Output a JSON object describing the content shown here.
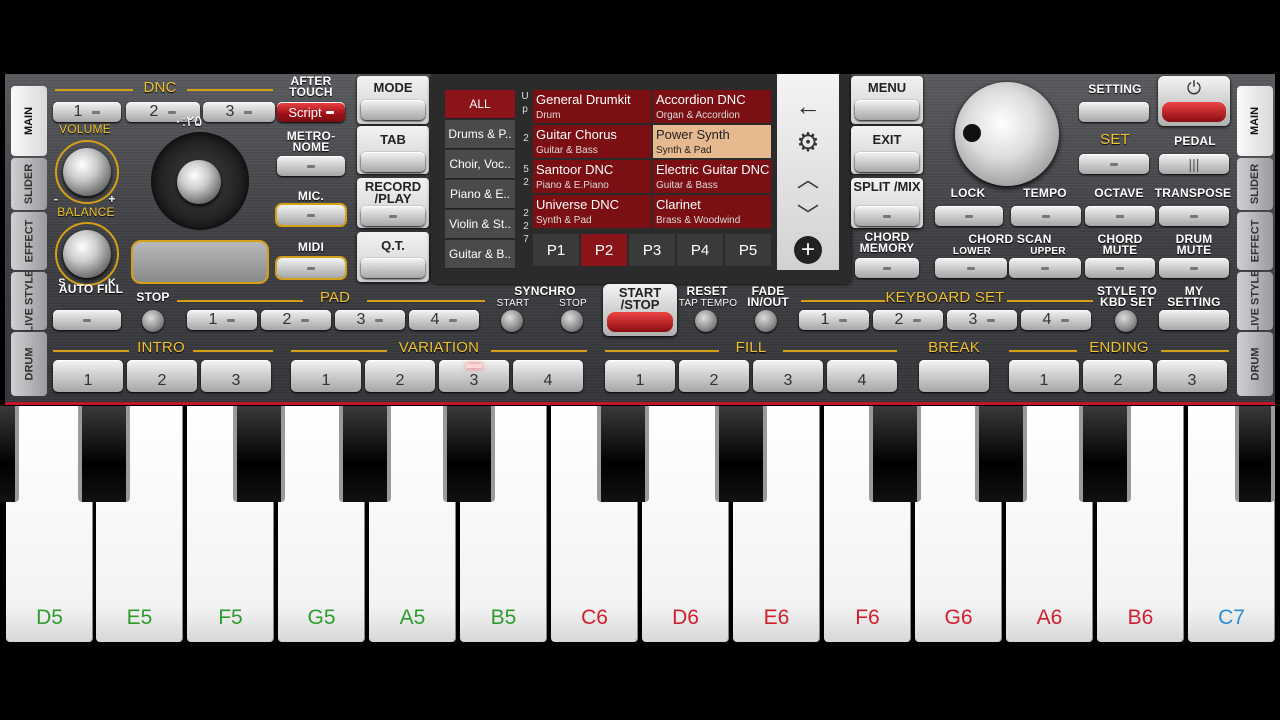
{
  "side_tabs_left": [
    "MAIN",
    "SLIDER",
    "EFFECT",
    "LIVE STYLE",
    "DRUM"
  ],
  "side_tabs_right": [
    "MAIN",
    "SLIDER",
    "EFFECT",
    "LIVE STYLE",
    "DRUM"
  ],
  "dnc": {
    "label": "DNC",
    "buttons": [
      "1",
      "2",
      "3"
    ],
    "overlay": "۰:۲۵"
  },
  "after_touch": {
    "label": "AFTER TOUCH",
    "value": "Script"
  },
  "volume_label": "VOLUME",
  "balance": {
    "label": "BALANCE",
    "s": "S",
    "k": "K",
    "minus": "-",
    "plus": "+"
  },
  "metronome_label": "METRO-NOME",
  "mic_label": "MIC.",
  "midi_label": "MIDI",
  "mode_col": {
    "mode": "MODE",
    "tab": "TAB",
    "record": "RECORD /PLAY",
    "qt": "Q.T."
  },
  "display": {
    "categories": [
      "ALL",
      "Drums & P..",
      "Choir, Voc..",
      "Piano & E..",
      "Violin & St..",
      "Guitar & B.."
    ],
    "up_label": "U p",
    "page_digits": [
      "2",
      "5",
      "2",
      "2",
      "2",
      "7"
    ],
    "voices": [
      {
        "name": "General Drumkit",
        "cat": "Drum"
      },
      {
        "name": "Accordion DNC",
        "cat": "Organ & Accordion"
      },
      {
        "name": "Guitar Chorus",
        "cat": "Guitar & Bass"
      },
      {
        "name": "Power Synth",
        "cat": "Synth & Pad"
      },
      {
        "name": "Santoor DNC",
        "cat": "Piano & E.Piano"
      },
      {
        "name": "Electric Guitar DNC",
        "cat": "Guitar & Bass"
      },
      {
        "name": "Universe DNC",
        "cat": "Synth & Pad"
      },
      {
        "name": "Clarinet",
        "cat": "Brass & Woodwind"
      }
    ],
    "pages": [
      "P1",
      "P2",
      "P3",
      "P4",
      "P5"
    ],
    "selected_page": "P2",
    "selected_voice": "Power Synth"
  },
  "right_col": {
    "menu": "MENU",
    "exit": "EXIT",
    "split": "SPLIT /MIX",
    "chord_memory": "CHORD MEMORY"
  },
  "setting_label": "SETTING",
  "set_label": "SET",
  "pedal_label": "PEDAL",
  "lock_label": "LOCK",
  "tempo_label": "TEMPO",
  "octave_label": "OCTAVE",
  "transpose_label": "TRANSPOSE",
  "chord_scan": {
    "label": "CHORD SCAN",
    "lower": "LOWER",
    "upper": "UPPER"
  },
  "chord_mute": "CHORD MUTE",
  "drum_mute": "DRUM MUTE",
  "auto_fill": "AUTO FILL",
  "stop_label": "STOP",
  "pad": {
    "label": "PAD",
    "buttons": [
      "1",
      "2",
      "3",
      "4"
    ]
  },
  "synchro": {
    "label": "SYNCHRO",
    "start": "START",
    "stop": "STOP"
  },
  "start_stop": "START /STOP",
  "reset": {
    "label": "RESET",
    "sub": "TAP TEMPO"
  },
  "fade": "FADE IN/OUT",
  "keyboard_set": {
    "label": "KEYBOARD SET",
    "buttons": [
      "1",
      "2",
      "3",
      "4"
    ]
  },
  "style_to_kbd": "STYLE TO KBD SET",
  "my_setting": "MY SETTING",
  "intro": {
    "label": "INTRO",
    "buttons": [
      "1",
      "2",
      "3"
    ]
  },
  "variation": {
    "label": "VARIATION",
    "buttons": [
      "1",
      "2",
      "3",
      "4"
    ]
  },
  "fill": {
    "label": "FILL",
    "buttons": [
      "1",
      "2",
      "3",
      "4"
    ]
  },
  "break_label": "BREAK",
  "ending": {
    "label": "ENDING",
    "buttons": [
      "1",
      "2",
      "3"
    ]
  },
  "white_keys": [
    {
      "note": "D5",
      "color": "#2e9d2e"
    },
    {
      "note": "E5",
      "color": "#2e9d2e"
    },
    {
      "note": "F5",
      "color": "#2e9d2e"
    },
    {
      "note": "G5",
      "color": "#2e9d2e"
    },
    {
      "note": "A5",
      "color": "#2e9d2e"
    },
    {
      "note": "B5",
      "color": "#2e9d2e"
    },
    {
      "note": "C6",
      "color": "#d21f2e"
    },
    {
      "note": "D6",
      "color": "#d21f2e"
    },
    {
      "note": "E6",
      "color": "#d21f2e"
    },
    {
      "note": "F6",
      "color": "#d21f2e"
    },
    {
      "note": "G6",
      "color": "#d21f2e"
    },
    {
      "note": "A6",
      "color": "#d21f2e"
    },
    {
      "note": "B6",
      "color": "#d21f2e"
    },
    {
      "note": "C7",
      "color": "#2a8fd1"
    }
  ],
  "colors": {
    "accent_gold": "#d4a017",
    "accent_red": "#8b1418",
    "selected_voice": "#e6b98f"
  }
}
